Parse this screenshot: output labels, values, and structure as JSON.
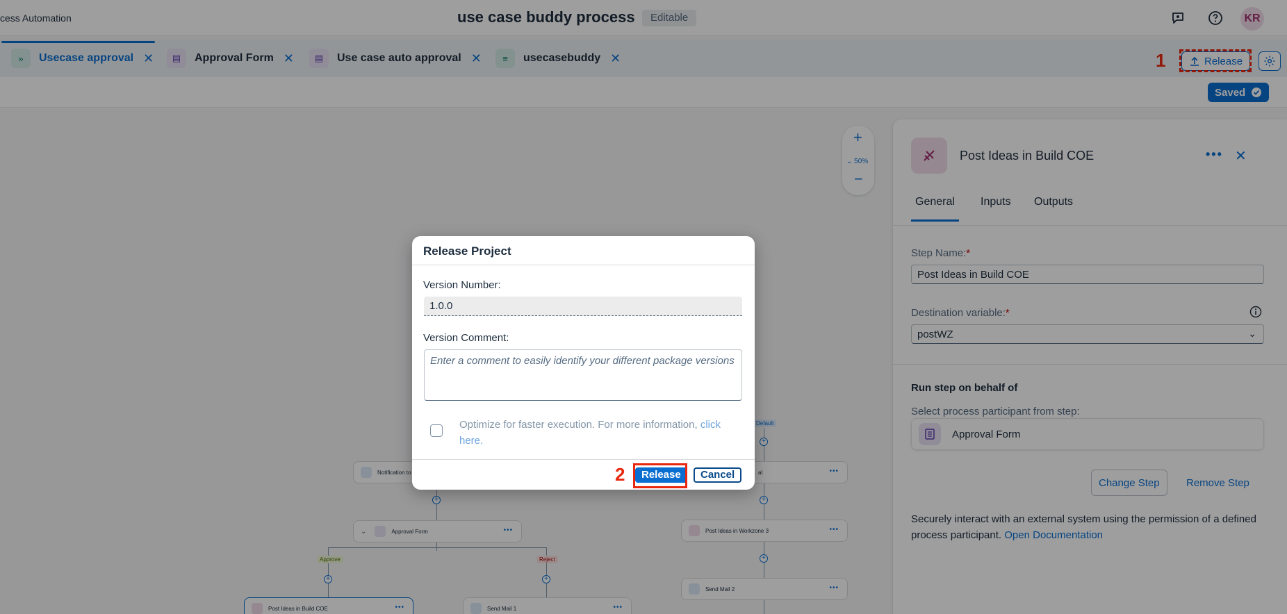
{
  "shell": {
    "app_name": "cess Automation",
    "title": "use case buddy process",
    "mode_badge": "Editable",
    "avatar_initials": "KR"
  },
  "tabs": [
    {
      "label": "Usecase approval",
      "icon": "process-icon",
      "active": true
    },
    {
      "label": "Approval Form",
      "icon": "form-icon",
      "active": false
    },
    {
      "label": "Use case auto approval",
      "icon": "form-icon",
      "active": false
    },
    {
      "label": "usecasebuddy",
      "icon": "data-type-icon",
      "active": false
    }
  ],
  "toolbar": {
    "release_label": "Release",
    "saved_label": "Saved",
    "annotation_1": "1"
  },
  "zoom": {
    "level": "50%"
  },
  "canvas": {
    "nodes": [
      {
        "label": "Notification to"
      },
      {
        "label": "Approval Form"
      },
      {
        "label": "Post Ideas in Build COE"
      },
      {
        "label": "Send Mail 1"
      },
      {
        "label": "Post Ideas in Workzone 3"
      },
      {
        "label": "Send Mail 2"
      },
      {
        "label": "al"
      }
    ],
    "chips": {
      "approve": "Approve",
      "reject": "Reject",
      "default": "Default"
    }
  },
  "panel": {
    "title": "Post Ideas in Build COE",
    "tabs": [
      "General",
      "Inputs",
      "Outputs"
    ],
    "step_name_label": "Step Name:",
    "step_name_value": "Post Ideas in Build COE",
    "destination_label": "Destination variable:",
    "destination_value": "postWZ",
    "required_mark": "*",
    "run_on_behalf_heading": "Run step on behalf of",
    "participant_label": "Select process participant from step:",
    "participant_value": "Approval Form",
    "change_step": "Change Step",
    "remove_step": "Remove Step",
    "description": "Securely interact with an external system using the permission of a defined process participant.",
    "doc_link": "Open Documentation"
  },
  "dialog": {
    "title": "Release Project",
    "version_number_label": "Version Number:",
    "version_number_value": "1.0.0",
    "version_comment_label": "Version Comment:",
    "version_comment_placeholder": "Enter a comment to easily identify your different package versions",
    "optimize_text": "Optimize for faster execution. For more information,",
    "optimize_link": "click here.",
    "release_button": "Release",
    "cancel_button": "Cancel",
    "annotation_2": "2"
  },
  "colors": {
    "accent": "#0a6ed1",
    "annotation": "#e8270e"
  }
}
